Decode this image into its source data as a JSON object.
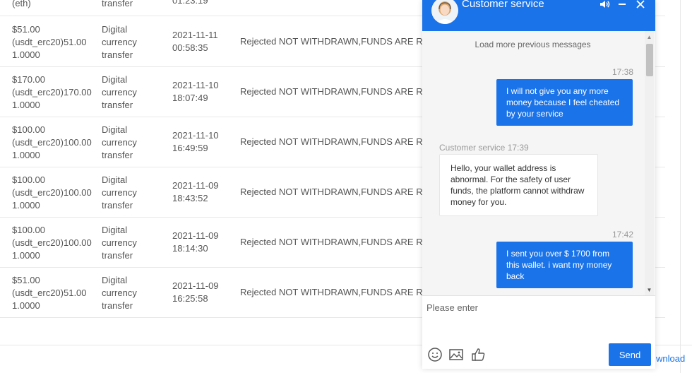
{
  "table": {
    "top_row": {
      "amount_line2": "(eth)",
      "type_line3": "transfer",
      "time_line2": "01:23:19"
    },
    "rows": [
      {
        "amount_line1": "$51.00",
        "amount_line2": "(usdt_erc20)51.00",
        "amount_line3": "1.0000",
        "type_line1": "Digital",
        "type_line2": "currency",
        "type_line3": "transfer",
        "date": "2021-11-11",
        "time": "00:58:35",
        "status": "Rejected NOT WITHDRAWN,FUNDS ARE RE"
      },
      {
        "amount_line1": "$170.00",
        "amount_line2": "(usdt_erc20)170.00",
        "amount_line3": "1.0000",
        "type_line1": "Digital",
        "type_line2": "currency",
        "type_line3": "transfer",
        "date": "2021-11-10",
        "time": "18:07:49",
        "status": "Rejected NOT WITHDRAWN,FUNDS ARE RE"
      },
      {
        "amount_line1": "$100.00",
        "amount_line2": "(usdt_erc20)100.00",
        "amount_line3": "1.0000",
        "type_line1": "Digital",
        "type_line2": "currency",
        "type_line3": "transfer",
        "date": "2021-11-10",
        "time": "16:49:59",
        "status": "Rejected NOT WITHDRAWN,FUNDS ARE RE"
      },
      {
        "amount_line1": "$100.00",
        "amount_line2": "(usdt_erc20)100.00",
        "amount_line3": "1.0000",
        "type_line1": "Digital",
        "type_line2": "currency",
        "type_line3": "transfer",
        "date": "2021-11-09",
        "time": "18:43:52",
        "status": "Rejected NOT WITHDRAWN,FUNDS ARE RE"
      },
      {
        "amount_line1": "$100.00",
        "amount_line2": "(usdt_erc20)100.00",
        "amount_line3": "1.0000",
        "type_line1": "Digital",
        "type_line2": "currency",
        "type_line3": "transfer",
        "date": "2021-11-09",
        "time": "18:14:30",
        "status": "Rejected NOT WITHDRAWN,FUNDS ARE RE"
      },
      {
        "amount_line1": "$51.00",
        "amount_line2": "(usdt_erc20)51.00",
        "amount_line3": "1.0000",
        "type_line1": "Digital",
        "type_line2": "currency",
        "type_line3": "transfer",
        "date": "2021-11-09",
        "time": "16:25:58",
        "status": "Rejected NOT WITHDRAWN,FUNDS ARE RE"
      }
    ]
  },
  "footer": {
    "download_label": "wnload"
  },
  "chat": {
    "title": "Customer service",
    "header_icons": [
      "speaker-icon",
      "minimize-icon",
      "close-icon"
    ],
    "load_more": "Load more previous messages",
    "messages": [
      {
        "direction": "out",
        "time": "17:38",
        "text": "I will not give you any more money because I feel cheated by your service"
      },
      {
        "direction": "in",
        "sender_time": "Customer service 17:39",
        "text": "Hello, your wallet address is abnormal. For the safety of user funds, the platform cannot withdraw money for you."
      },
      {
        "direction": "out",
        "time": "17:42",
        "text": "I sent you over $ 1700 from this wallet. i want my money back"
      }
    ],
    "input_placeholder": "Please enter",
    "input_value": "",
    "tool_icons": [
      "emoji-icon",
      "image-icon",
      "thumbs-up-icon"
    ],
    "send_label": "Send",
    "colors": {
      "accent": "#1a73e8",
      "chat_bg": "#f5f5f5"
    }
  }
}
